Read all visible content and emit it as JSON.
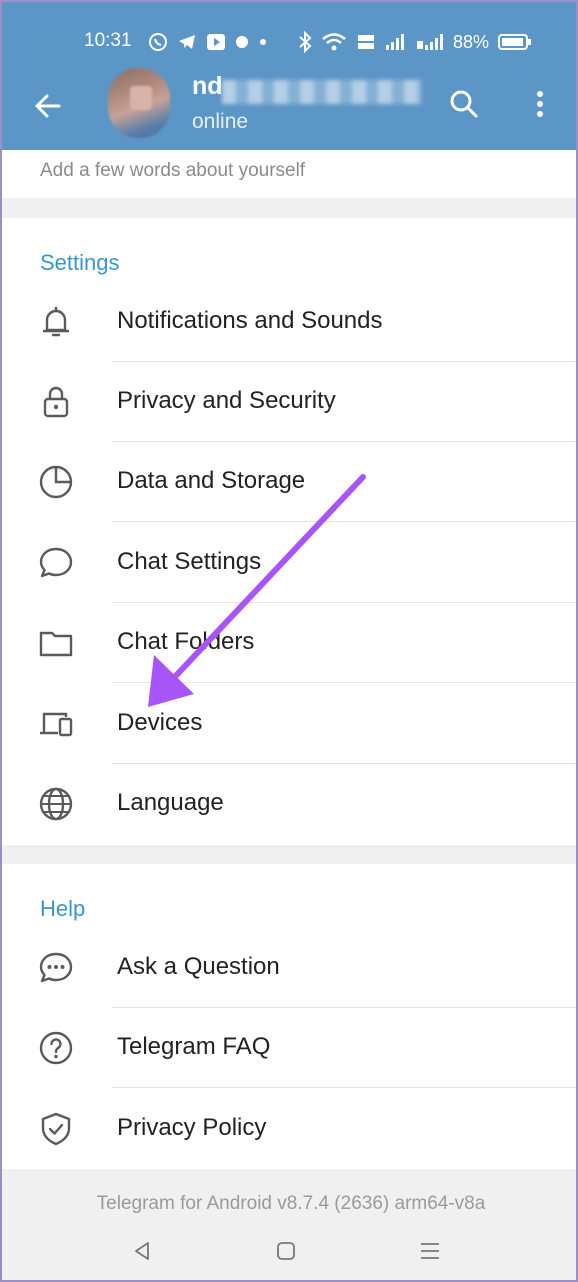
{
  "status_bar": {
    "time": "10:31",
    "battery": "88%"
  },
  "header": {
    "name": "nd",
    "status": "online"
  },
  "bio": {
    "placeholder": "Add a few words about yourself"
  },
  "settings": {
    "title": "Settings",
    "items": [
      {
        "label": "Notifications and Sounds",
        "icon": "bell-icon"
      },
      {
        "label": "Privacy and Security",
        "icon": "lock-icon"
      },
      {
        "label": "Data and Storage",
        "icon": "pie-chart-icon"
      },
      {
        "label": "Chat Settings",
        "icon": "chat-bubble-icon"
      },
      {
        "label": "Chat Folders",
        "icon": "folder-icon"
      },
      {
        "label": "Devices",
        "icon": "devices-icon"
      },
      {
        "label": "Language",
        "icon": "globe-icon"
      }
    ]
  },
  "help": {
    "title": "Help",
    "items": [
      {
        "label": "Ask a Question",
        "icon": "chat-dots-icon"
      },
      {
        "label": "Telegram FAQ",
        "icon": "question-circle-icon"
      },
      {
        "label": "Privacy Policy",
        "icon": "shield-check-icon"
      }
    ]
  },
  "footer": {
    "version": "Telegram for Android v8.7.4 (2636) arm64-v8a"
  },
  "colors": {
    "header": "#5b96c7",
    "section_title": "#3a95cf",
    "annotation_arrow": "#a855f7"
  }
}
